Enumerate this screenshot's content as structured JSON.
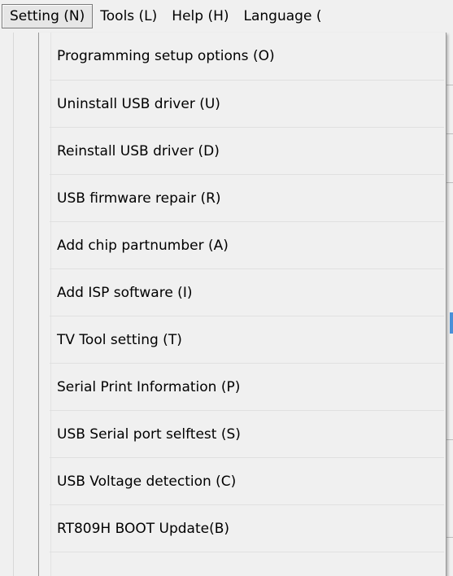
{
  "menubar": {
    "items": [
      {
        "label": "Setting (N)",
        "active": true
      },
      {
        "label": "Tools (L)"
      },
      {
        "label": "Help (H)"
      },
      {
        "label": "Language ("
      }
    ]
  },
  "dropdown": {
    "items": [
      {
        "label": "Programming setup options (O)"
      },
      {
        "label": "Uninstall USB driver (U)"
      },
      {
        "label": "Reinstall USB driver (D)"
      },
      {
        "label": "USB firmware repair (R)"
      },
      {
        "label": "Add chip partnumber (A)"
      },
      {
        "label": "Add ISP software (I)"
      },
      {
        "label": "TV Tool setting (T)"
      },
      {
        "label": "Serial Print Information (P)"
      },
      {
        "label": "USB Serial port selftest (S)"
      },
      {
        "label": "USB Voltage detection (C)"
      },
      {
        "label": "RT809H BOOT Update(B)"
      }
    ]
  },
  "colors": {
    "menu_background": "#f0f0f0",
    "active_menu_border": "#7a7a7a",
    "background_accent": "#4a90d9"
  }
}
